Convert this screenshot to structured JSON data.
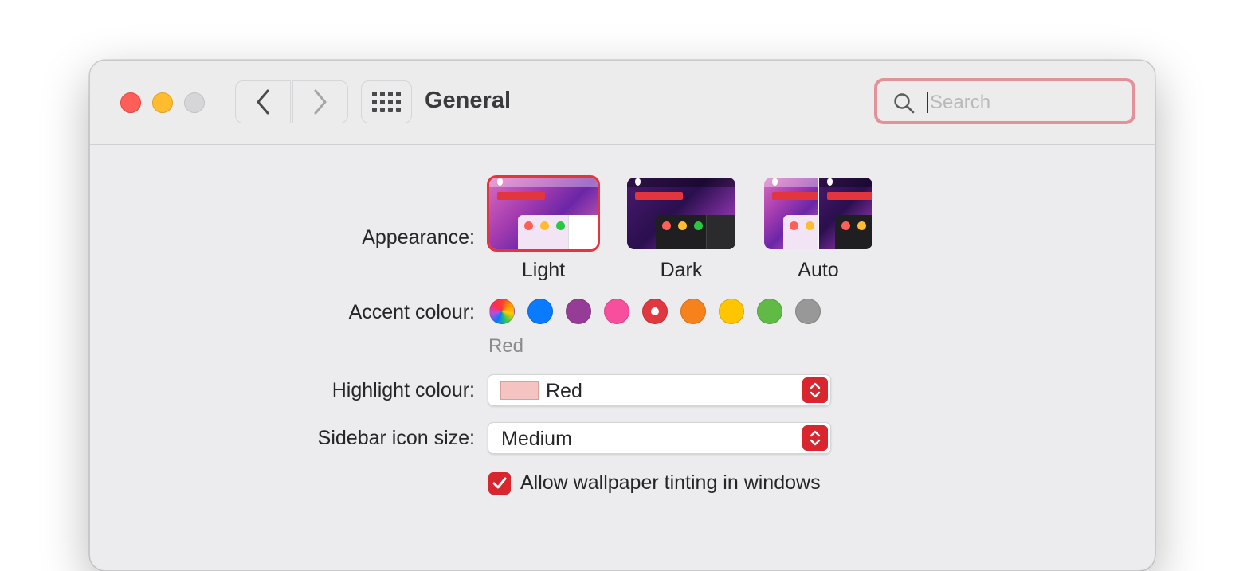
{
  "window": {
    "title": "General",
    "search_placeholder": "Search"
  },
  "appearance": {
    "label": "Appearance:",
    "options": [
      {
        "name": "Light",
        "selected": true
      },
      {
        "name": "Dark",
        "selected": false
      },
      {
        "name": "Auto",
        "selected": false
      }
    ]
  },
  "accent": {
    "label": "Accent colour:",
    "selected_name": "Red",
    "colors": [
      {
        "name": "multicolour",
        "hex": "conic"
      },
      {
        "name": "blue",
        "hex": "#0a7aff"
      },
      {
        "name": "purple",
        "hex": "#953d96"
      },
      {
        "name": "pink",
        "hex": "#f74f9e"
      },
      {
        "name": "red",
        "hex": "#e0383e",
        "selected": true
      },
      {
        "name": "orange",
        "hex": "#f7821b"
      },
      {
        "name": "yellow",
        "hex": "#ffc600"
      },
      {
        "name": "green",
        "hex": "#62ba46"
      },
      {
        "name": "graphite",
        "hex": "#989898"
      }
    ]
  },
  "highlight": {
    "label": "Highlight colour:",
    "value": "Red",
    "chip_color": "#f6c3c3"
  },
  "sidebar_icon_size": {
    "label": "Sidebar icon size:",
    "value": "Medium"
  },
  "wallpaper_tinting": {
    "label": "Allow wallpaper tinting in windows",
    "checked": true
  }
}
